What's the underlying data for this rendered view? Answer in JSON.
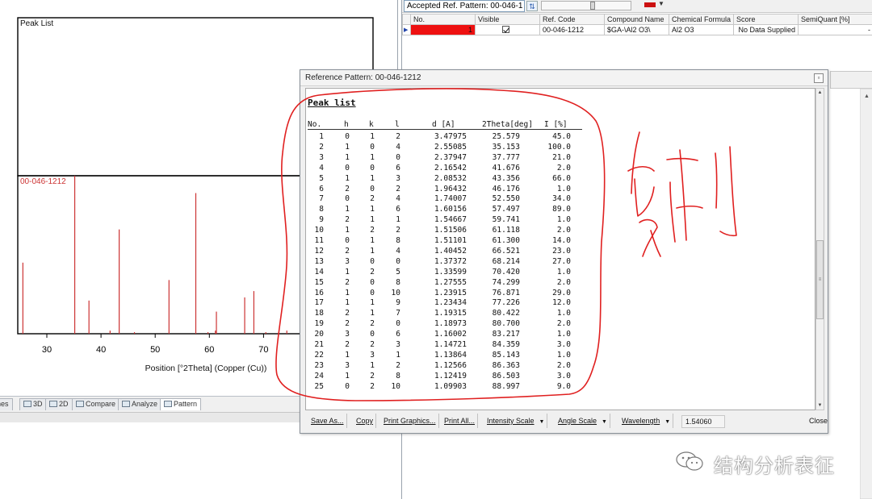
{
  "chart_window": {
    "chart_data": {
      "type": "bar",
      "title": "Peak List",
      "series": [
        {
          "name": "00-046-1212",
          "x": [
            25.579,
            35.153,
            37.777,
            41.676,
            43.356,
            46.176,
            52.55,
            57.497,
            59.741,
            61.118,
            61.3,
            66.521,
            68.214,
            70.42,
            74.299,
            76.871,
            77.226,
            80.422,
            80.7,
            83.217,
            84.359,
            85.143,
            86.363,
            86.503,
            88.997
          ],
          "values": [
            45.0,
            100.0,
            21.0,
            2.0,
            66.0,
            1.0,
            34.0,
            89.0,
            1.0,
            2.0,
            14.0,
            23.0,
            27.0,
            1.0,
            2.0,
            29.0,
            12.0,
            1.0,
            2.0,
            1.0,
            3.0,
            1.0,
            2.0,
            3.0,
            9.0
          ]
        }
      ],
      "xlabel": "Position [°2Theta] (Copper (Cu))",
      "xticks": [
        "30",
        "40",
        "50",
        "60",
        "70"
      ],
      "xlim": [
        21.4,
        76.6
      ],
      "ylim": [
        0,
        100
      ],
      "grid": false
    },
    "tabs": [
      {
        "label": "Lines",
        "active": false
      },
      {
        "label": "3D",
        "active": false
      },
      {
        "label": "2D",
        "active": false
      },
      {
        "label": "Compare",
        "active": false
      },
      {
        "label": "Analyze",
        "active": false
      },
      {
        "label": "Pattern",
        "active": true
      }
    ],
    "colors": {
      "pattern": "#cc3333",
      "frame": "#000000"
    }
  },
  "right_panel": {
    "selector_label": "Accepted Ref. Pattern: 00-046-1",
    "columns": [
      "No.",
      "Visible",
      "Ref. Code",
      "Compound Name",
      "Chemical Formula",
      "Score",
      "SemiQuant [%]"
    ],
    "rows": [
      {
        "no": "1",
        "visible": true,
        "ref_code": "00-046-1212",
        "compound_name": "$GA-\\Al2 O3\\",
        "formula": "Al2 O3",
        "score": "No Data Supplied",
        "semiquant": "-"
      }
    ],
    "colors": {
      "row_color": "#ee1111"
    }
  },
  "dialog": {
    "title": "Reference Pattern: 00-046-1212",
    "close_icon": "close-icon",
    "peak_list": {
      "title": "Peak list",
      "headers": [
        "No.",
        "h",
        "k",
        "l",
        "d [A]",
        "2Theta[deg]",
        "I [%]"
      ],
      "rows": [
        [
          "1",
          "0",
          "1",
          "2",
          "3.47975",
          "25.579",
          "45.0"
        ],
        [
          "2",
          "1",
          "0",
          "4",
          "2.55085",
          "35.153",
          "100.0"
        ],
        [
          "3",
          "1",
          "1",
          "0",
          "2.37947",
          "37.777",
          "21.0"
        ],
        [
          "4",
          "0",
          "0",
          "6",
          "2.16542",
          "41.676",
          "2.0"
        ],
        [
          "5",
          "1",
          "1",
          "3",
          "2.08532",
          "43.356",
          "66.0"
        ],
        [
          "6",
          "2",
          "0",
          "2",
          "1.96432",
          "46.176",
          "1.0"
        ],
        [
          "7",
          "0",
          "2",
          "4",
          "1.74007",
          "52.550",
          "34.0"
        ],
        [
          "8",
          "1",
          "1",
          "6",
          "1.60156",
          "57.497",
          "89.0"
        ],
        [
          "9",
          "2",
          "1",
          "1",
          "1.54667",
          "59.741",
          "1.0"
        ],
        [
          "10",
          "1",
          "2",
          "2",
          "1.51506",
          "61.118",
          "2.0"
        ],
        [
          "11",
          "0",
          "1",
          "8",
          "1.51101",
          "61.300",
          "14.0"
        ],
        [
          "12",
          "2",
          "1",
          "4",
          "1.40452",
          "66.521",
          "23.0"
        ],
        [
          "13",
          "3",
          "0",
          "0",
          "1.37372",
          "68.214",
          "27.0"
        ],
        [
          "14",
          "1",
          "2",
          "5",
          "1.33599",
          "70.420",
          "1.0"
        ],
        [
          "15",
          "2",
          "0",
          "8",
          "1.27555",
          "74.299",
          "2.0"
        ],
        [
          "16",
          "1",
          "0",
          "10",
          "1.23915",
          "76.871",
          "29.0"
        ],
        [
          "17",
          "1",
          "1",
          "9",
          "1.23434",
          "77.226",
          "12.0"
        ],
        [
          "18",
          "2",
          "1",
          "7",
          "1.19315",
          "80.422",
          "1.0"
        ],
        [
          "19",
          "2",
          "2",
          "0",
          "1.18973",
          "80.700",
          "2.0"
        ],
        [
          "20",
          "3",
          "0",
          "6",
          "1.16002",
          "83.217",
          "1.0"
        ],
        [
          "21",
          "2",
          "2",
          "3",
          "1.14721",
          "84.359",
          "3.0"
        ],
        [
          "22",
          "1",
          "3",
          "1",
          "1.13864",
          "85.143",
          "1.0"
        ],
        [
          "23",
          "3",
          "1",
          "2",
          "1.12566",
          "86.363",
          "2.0"
        ],
        [
          "24",
          "1",
          "2",
          "8",
          "1.12419",
          "86.503",
          "3.0"
        ],
        [
          "25",
          "0",
          "2",
          "10",
          "1.09903",
          "88.997",
          "9.0"
        ]
      ]
    },
    "toolbar": {
      "save_as": "Save As...",
      "copy": "Copy",
      "print_graphics": "Print Graphics...",
      "print_all": "Print All...",
      "intensity_scale": "Intensity Scale",
      "angle_scale": "Angle Scale",
      "wavelength": "Wavelength",
      "wavelength_value": "1.54060",
      "close": "Close"
    }
  },
  "annotations": {
    "colors": {
      "ink": "#e02020"
    }
  },
  "watermark": {
    "text": "结构分析表征",
    "icon": "wechat-icon"
  }
}
